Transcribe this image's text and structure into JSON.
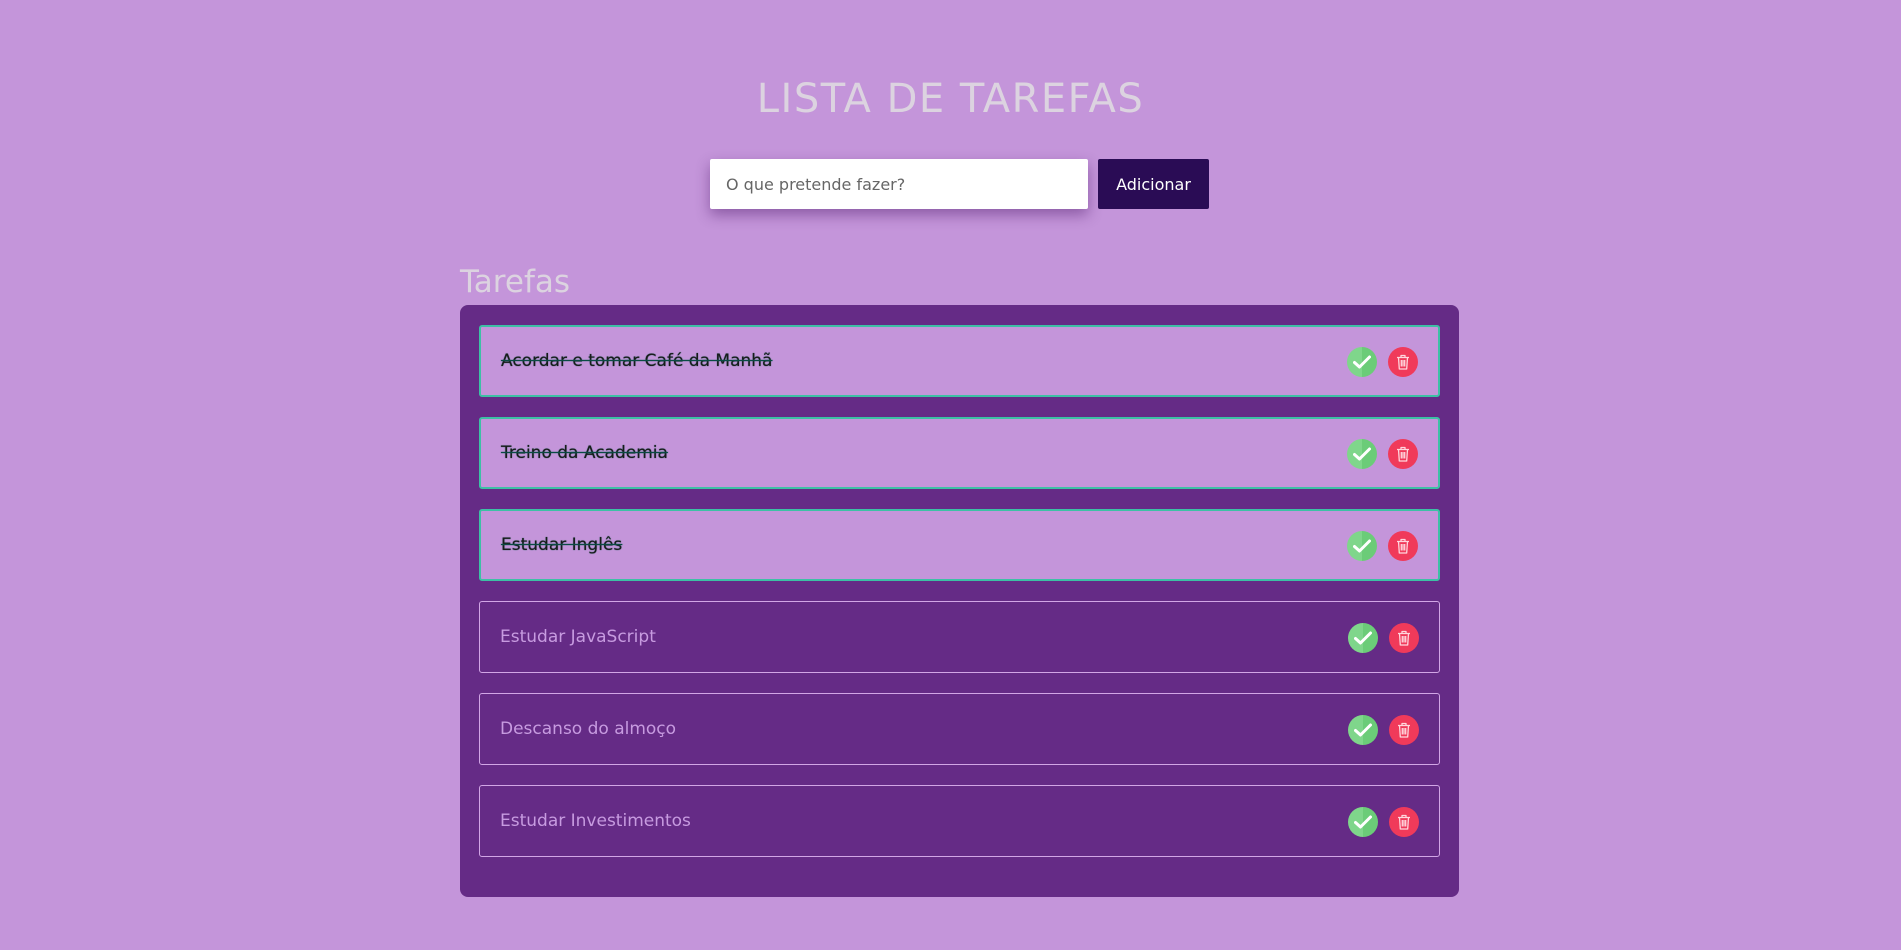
{
  "header": {
    "title": "LISTA DE TAREFAS"
  },
  "form": {
    "placeholder": "O que pretende fazer?",
    "value": "",
    "add_label": "Adicionar"
  },
  "tasks_section": {
    "title": "Tarefas",
    "items": [
      {
        "label": "Acordar e tomar Café da Manhã",
        "done": true
      },
      {
        "label": "Treino da Academia",
        "done": true
      },
      {
        "label": "Estudar Inglês",
        "done": true
      },
      {
        "label": "Estudar JavaScript",
        "done": false
      },
      {
        "label": "Descanso do almoço",
        "done": false
      },
      {
        "label": "Estudar Investimentos",
        "done": false
      }
    ]
  },
  "icons": {
    "complete": "check-icon",
    "delete": "trash-icon"
  },
  "colors": {
    "background": "#c495da",
    "panel": "#652b86",
    "button": "#2a0c55",
    "done_border": "#3dc0a5",
    "check": "#7fd68b",
    "delete": "#f03a5a"
  }
}
